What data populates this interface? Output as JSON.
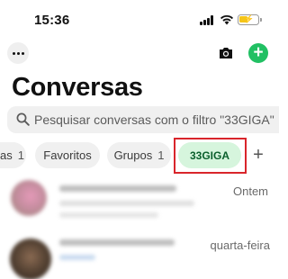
{
  "status_bar": {
    "time": "15:36"
  },
  "header": {
    "title": "Conversas",
    "more_icon": "ellipsis-icon",
    "camera_icon": "camera-icon",
    "new_chat_label": "+"
  },
  "search": {
    "placeholder": "Pesquisar conversas com o filtro \"33GIGA\""
  },
  "filters": {
    "items": [
      {
        "label": "as",
        "count": "1"
      },
      {
        "label": "Favoritos",
        "count": ""
      },
      {
        "label": "Grupos",
        "count": "1"
      },
      {
        "label": "33GIGA",
        "count": ""
      }
    ],
    "add_label": "+",
    "active_color": "#d6f5dd",
    "highlight_color": "#d9252b"
  },
  "chats": [
    {
      "time": "Ontem"
    },
    {
      "time": "quarta-feira"
    }
  ],
  "colors": {
    "accent": "#21c063"
  }
}
